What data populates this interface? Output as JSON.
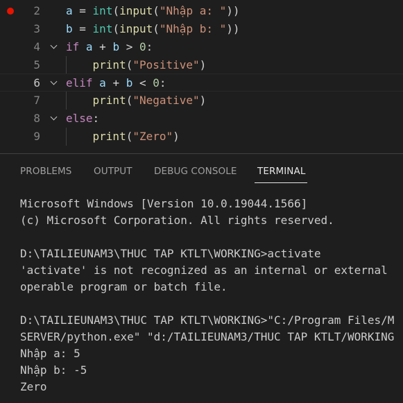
{
  "editor": {
    "lines": [
      {
        "number": "2",
        "has_breakpoint": true,
        "foldable": false,
        "tokens": [
          {
            "t": "a",
            "c": "var"
          },
          {
            "t": " = ",
            "c": "plain"
          },
          {
            "t": "int",
            "c": "bi"
          },
          {
            "t": "(",
            "c": "plain"
          },
          {
            "t": "input",
            "c": "fn"
          },
          {
            "t": "(",
            "c": "plain"
          },
          {
            "t": "\"Nhập a: \"",
            "c": "str"
          },
          {
            "t": "))",
            "c": "plain"
          }
        ]
      },
      {
        "number": "3",
        "has_breakpoint": false,
        "foldable": false,
        "tokens": [
          {
            "t": "b",
            "c": "var"
          },
          {
            "t": " = ",
            "c": "plain"
          },
          {
            "t": "int",
            "c": "bi"
          },
          {
            "t": "(",
            "c": "plain"
          },
          {
            "t": "input",
            "c": "fn"
          },
          {
            "t": "(",
            "c": "plain"
          },
          {
            "t": "\"Nhập b: \"",
            "c": "str"
          },
          {
            "t": "))",
            "c": "plain"
          }
        ]
      },
      {
        "number": "4",
        "has_breakpoint": false,
        "foldable": true,
        "tokens": [
          {
            "t": "if",
            "c": "kw"
          },
          {
            "t": " ",
            "c": "plain"
          },
          {
            "t": "a",
            "c": "var"
          },
          {
            "t": " + ",
            "c": "plain"
          },
          {
            "t": "b",
            "c": "var"
          },
          {
            "t": " > ",
            "c": "plain"
          },
          {
            "t": "0",
            "c": "num"
          },
          {
            "t": ":",
            "c": "plain"
          }
        ]
      },
      {
        "number": "5",
        "has_breakpoint": false,
        "foldable": false,
        "indent": true,
        "tokens": [
          {
            "t": "    ",
            "c": "plain"
          },
          {
            "t": "print",
            "c": "fn"
          },
          {
            "t": "(",
            "c": "plain"
          },
          {
            "t": "\"Positive\"",
            "c": "str"
          },
          {
            "t": ")",
            "c": "plain"
          }
        ]
      },
      {
        "number": "6",
        "has_breakpoint": false,
        "foldable": true,
        "current": true,
        "tokens": [
          {
            "t": "elif",
            "c": "kw"
          },
          {
            "t": " ",
            "c": "plain"
          },
          {
            "t": "a",
            "c": "var"
          },
          {
            "t": " + ",
            "c": "plain"
          },
          {
            "t": "b",
            "c": "var"
          },
          {
            "t": " < ",
            "c": "plain"
          },
          {
            "t": "0",
            "c": "num"
          },
          {
            "t": ":",
            "c": "plain"
          }
        ]
      },
      {
        "number": "7",
        "has_breakpoint": false,
        "foldable": false,
        "indent": true,
        "tokens": [
          {
            "t": "    ",
            "c": "plain"
          },
          {
            "t": "print",
            "c": "fn"
          },
          {
            "t": "(",
            "c": "plain"
          },
          {
            "t": "\"Negative\"",
            "c": "str"
          },
          {
            "t": ")",
            "c": "plain"
          }
        ]
      },
      {
        "number": "8",
        "has_breakpoint": false,
        "foldable": true,
        "tokens": [
          {
            "t": "else",
            "c": "kw"
          },
          {
            "t": ":",
            "c": "plain"
          }
        ]
      },
      {
        "number": "9",
        "has_breakpoint": false,
        "foldable": false,
        "indent": true,
        "tokens": [
          {
            "t": "    ",
            "c": "plain"
          },
          {
            "t": "print",
            "c": "fn"
          },
          {
            "t": "(",
            "c": "plain"
          },
          {
            "t": "\"Zero\"",
            "c": "str"
          },
          {
            "t": ")",
            "c": "plain"
          }
        ]
      }
    ]
  },
  "panel": {
    "tabs": [
      {
        "label": "PROBLEMS",
        "active": false
      },
      {
        "label": "OUTPUT",
        "active": false
      },
      {
        "label": "DEBUG CONSOLE",
        "active": false
      },
      {
        "label": "TERMINAL",
        "active": true
      }
    ]
  },
  "terminal": {
    "lines": [
      "Microsoft Windows [Version 10.0.19044.1566]",
      "(c) Microsoft Corporation. All rights reserved.",
      "",
      "D:\\TAILIEUNAM3\\THUC TAP KTLT\\WORKING>activate",
      "'activate' is not recognized as an internal or external",
      "operable program or batch file.",
      "",
      "D:\\TAILIEUNAM3\\THUC TAP KTLT\\WORKING>\"C:/Program Files/M",
      "SERVER/python.exe\" \"d:/TAILIEUNAM3/THUC TAP KTLT/WORKING",
      "Nhập a: 5",
      "Nhập b: -5",
      "Zero"
    ]
  },
  "colors": {
    "background": "#1e1e1e",
    "breakpoint": "#e51400",
    "keyword": "#c586c0",
    "function": "#dcdcaa",
    "builtin": "#4ec9b0",
    "string": "#ce9178",
    "number": "#b5cea8",
    "variable": "#9cdcfe"
  }
}
